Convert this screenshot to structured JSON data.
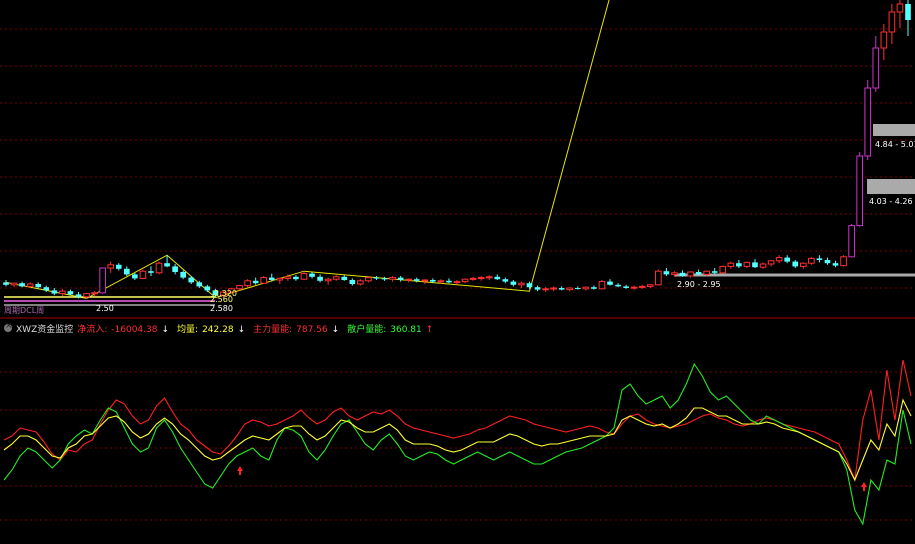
{
  "indicator_header": {
    "title": "XWZ资金监控",
    "items": [
      {
        "label": "净流入:",
        "value": "-16004.38",
        "arrow": "↓",
        "color": "red"
      },
      {
        "label": "均量:",
        "value": "242.28",
        "arrow": "↓",
        "color": "yellow"
      },
      {
        "label": "主力量能:",
        "value": "787.56",
        "arrow": "↓",
        "color": "red"
      },
      {
        "label": "散户量能:",
        "value": "360.81",
        "arrow": "↑",
        "color": "green"
      }
    ]
  },
  "price_labels": [
    {
      "text": "4.84 - 5.01"
    },
    {
      "text": "4.03 - 4.26"
    },
    {
      "text": "2.90 - 2.95"
    },
    {
      "text": "2.50"
    },
    {
      "text": "2.560"
    },
    {
      "text": "2.320"
    },
    {
      "text": "2.580"
    }
  ],
  "left_caption": "周期DCL周",
  "colors": {
    "up": "#ff3030",
    "down": "#54ffff",
    "zigzag": "#e6e600",
    "limit_up": "#cc33cc",
    "grid": "#7a0000",
    "support_box": "#aaaaaa",
    "main_force": "#ff2020",
    "retail": "#22ee22",
    "average": "#ffff33"
  },
  "chart_data": [
    {
      "type": "candlestick",
      "panel": "price",
      "y_range": [
        2.3,
        6.0
      ],
      "candles": [
        [
          2.52,
          2.55,
          2.47,
          2.49
        ],
        [
          2.49,
          2.52,
          2.46,
          2.51
        ],
        [
          2.51,
          2.53,
          2.46,
          2.47
        ],
        [
          2.47,
          2.52,
          2.45,
          2.5
        ],
        [
          2.5,
          2.52,
          2.44,
          2.46
        ],
        [
          2.46,
          2.48,
          2.4,
          2.42
        ],
        [
          2.42,
          2.45,
          2.36,
          2.38
        ],
        [
          2.38,
          2.44,
          2.35,
          2.41
        ],
        [
          2.41,
          2.43,
          2.36,
          2.37
        ],
        [
          2.37,
          2.4,
          2.32,
          2.34
        ],
        [
          2.34,
          2.39,
          2.32,
          2.38
        ],
        [
          2.38,
          2.41,
          2.35,
          2.39
        ],
        [
          2.39,
          2.7,
          2.38,
          2.7
        ],
        [
          2.7,
          2.78,
          2.64,
          2.74
        ],
        [
          2.74,
          2.76,
          2.67,
          2.69
        ],
        [
          2.69,
          2.72,
          2.6,
          2.62
        ],
        [
          2.62,
          2.64,
          2.55,
          2.57
        ],
        [
          2.57,
          2.68,
          2.56,
          2.66
        ],
        [
          2.66,
          2.72,
          2.6,
          2.64
        ],
        [
          2.64,
          2.78,
          2.62,
          2.76
        ],
        [
          2.76,
          2.86,
          2.71,
          2.72
        ],
        [
          2.72,
          2.75,
          2.62,
          2.65
        ],
        [
          2.65,
          2.67,
          2.56,
          2.58
        ],
        [
          2.58,
          2.6,
          2.5,
          2.52
        ],
        [
          2.52,
          2.54,
          2.45,
          2.47
        ],
        [
          2.47,
          2.49,
          2.4,
          2.42
        ],
        [
          2.42,
          2.44,
          2.33,
          2.36
        ],
        [
          2.36,
          2.41,
          2.33,
          2.4
        ],
        [
          2.4,
          2.45,
          2.38,
          2.44
        ],
        [
          2.44,
          2.49,
          2.42,
          2.48
        ],
        [
          2.48,
          2.56,
          2.46,
          2.54
        ],
        [
          2.54,
          2.58,
          2.49,
          2.51
        ],
        [
          2.51,
          2.6,
          2.5,
          2.58
        ],
        [
          2.58,
          2.63,
          2.53,
          2.55
        ],
        [
          2.55,
          2.58,
          2.5,
          2.57
        ],
        [
          2.57,
          2.62,
          2.54,
          2.59
        ],
        [
          2.59,
          2.61,
          2.54,
          2.56
        ],
        [
          2.56,
          2.66,
          2.55,
          2.63
        ],
        [
          2.63,
          2.65,
          2.57,
          2.59
        ],
        [
          2.59,
          2.62,
          2.52,
          2.54
        ],
        [
          2.54,
          2.58,
          2.49,
          2.56
        ],
        [
          2.56,
          2.61,
          2.54,
          2.59
        ],
        [
          2.59,
          2.61,
          2.54,
          2.55
        ],
        [
          2.55,
          2.57,
          2.48,
          2.5
        ],
        [
          2.5,
          2.56,
          2.48,
          2.54
        ],
        [
          2.54,
          2.6,
          2.52,
          2.58
        ],
        [
          2.58,
          2.6,
          2.55,
          2.57
        ],
        [
          2.57,
          2.59,
          2.54,
          2.56
        ],
        [
          2.56,
          2.6,
          2.53,
          2.58
        ],
        [
          2.58,
          2.6,
          2.53,
          2.55
        ],
        [
          2.55,
          2.57,
          2.52,
          2.56
        ],
        [
          2.56,
          2.58,
          2.52,
          2.54
        ],
        [
          2.54,
          2.56,
          2.5,
          2.55
        ],
        [
          2.55,
          2.57,
          2.51,
          2.53
        ],
        [
          2.53,
          2.56,
          2.5,
          2.54
        ],
        [
          2.54,
          2.57,
          2.51,
          2.52
        ],
        [
          2.52,
          2.55,
          2.49,
          2.53
        ],
        [
          2.53,
          2.57,
          2.51,
          2.56
        ],
        [
          2.56,
          2.59,
          2.54,
          2.57
        ],
        [
          2.57,
          2.6,
          2.54,
          2.58
        ],
        [
          2.58,
          2.61,
          2.55,
          2.59
        ],
        [
          2.59,
          2.62,
          2.55,
          2.56
        ],
        [
          2.56,
          2.58,
          2.51,
          2.53
        ],
        [
          2.53,
          2.55,
          2.47,
          2.49
        ],
        [
          2.49,
          2.53,
          2.45,
          2.51
        ],
        [
          2.51,
          2.53,
          2.44,
          2.46
        ],
        [
          2.46,
          2.48,
          2.41,
          2.43
        ],
        [
          2.43,
          2.46,
          2.4,
          2.44
        ],
        [
          2.44,
          2.47,
          2.41,
          2.45
        ],
        [
          2.45,
          2.47,
          2.42,
          2.43
        ],
        [
          2.43,
          2.46,
          2.41,
          2.45
        ],
        [
          2.45,
          2.47,
          2.43,
          2.44
        ],
        [
          2.44,
          2.47,
          2.42,
          2.46
        ],
        [
          2.46,
          2.48,
          2.43,
          2.44
        ],
        [
          2.44,
          2.55,
          2.43,
          2.53
        ],
        [
          2.53,
          2.56,
          2.48,
          2.49
        ],
        [
          2.49,
          2.51,
          2.46,
          2.47
        ],
        [
          2.47,
          2.49,
          2.44,
          2.45
        ],
        [
          2.45,
          2.48,
          2.43,
          2.46
        ],
        [
          2.46,
          2.49,
          2.44,
          2.47
        ],
        [
          2.47,
          2.5,
          2.45,
          2.49
        ],
        [
          2.49,
          2.68,
          2.48,
          2.66
        ],
        [
          2.66,
          2.7,
          2.6,
          2.62
        ],
        [
          2.62,
          2.66,
          2.59,
          2.64
        ],
        [
          2.64,
          2.67,
          2.59,
          2.6
        ],
        [
          2.6,
          2.66,
          2.58,
          2.65
        ],
        [
          2.65,
          2.68,
          2.61,
          2.62
        ],
        [
          2.62,
          2.67,
          2.6,
          2.66
        ],
        [
          2.66,
          2.7,
          2.62,
          2.64
        ],
        [
          2.64,
          2.73,
          2.63,
          2.72
        ],
        [
          2.72,
          2.78,
          2.69,
          2.76
        ],
        [
          2.76,
          2.8,
          2.7,
          2.72
        ],
        [
          2.72,
          2.78,
          2.7,
          2.77
        ],
        [
          2.77,
          2.81,
          2.7,
          2.71
        ],
        [
          2.71,
          2.77,
          2.69,
          2.75
        ],
        [
          2.75,
          2.8,
          2.72,
          2.79
        ],
        [
          2.79,
          2.86,
          2.76,
          2.83
        ],
        [
          2.83,
          2.86,
          2.76,
          2.78
        ],
        [
          2.78,
          2.8,
          2.7,
          2.72
        ],
        [
          2.72,
          2.77,
          2.69,
          2.76
        ],
        [
          2.76,
          2.84,
          2.74,
          2.82
        ],
        [
          2.82,
          2.86,
          2.77,
          2.8
        ],
        [
          2.8,
          2.83,
          2.74,
          2.76
        ],
        [
          2.76,
          2.79,
          2.71,
          2.73
        ],
        [
          2.73,
          2.86,
          2.72,
          2.84
        ],
        [
          2.84,
          3.25,
          2.83,
          3.23
        ],
        [
          3.23,
          4.15,
          3.22,
          4.1
        ],
        [
          4.1,
          5.05,
          4.05,
          4.95
        ],
        [
          4.95,
          5.6,
          4.9,
          5.45
        ],
        [
          5.45,
          5.75,
          5.3,
          5.65
        ],
        [
          5.65,
          6.0,
          5.5,
          5.9
        ],
        [
          5.9,
          6.1,
          5.7,
          6.0
        ],
        [
          6.0,
          6.1,
          5.6,
          5.8
        ]
      ]
    },
    {
      "type": "line",
      "panel": "indicator",
      "y_range": [
        0,
        100
      ],
      "series": [
        {
          "name": "主力量能",
          "values": [
            50,
            52,
            56,
            55,
            54,
            49,
            43,
            40,
            45,
            44,
            48,
            50,
            58,
            65,
            70,
            68,
            62,
            58,
            60,
            67,
            71,
            64,
            58,
            55,
            50,
            47,
            44,
            43,
            47,
            52,
            58,
            60,
            59,
            57,
            58,
            60,
            62,
            65,
            61,
            58,
            60,
            64,
            66,
            62,
            60,
            62,
            64,
            63,
            65,
            62,
            58,
            56,
            55,
            54,
            53,
            52,
            51,
            52,
            53,
            55,
            56,
            58,
            60,
            62,
            61,
            60,
            58,
            57,
            56,
            55,
            54,
            55,
            56,
            57,
            56,
            54,
            53,
            58,
            62,
            63,
            60,
            58,
            57,
            56,
            57,
            58,
            60,
            62,
            63,
            61,
            60,
            58,
            57,
            58,
            60,
            61,
            60,
            58,
            57,
            56,
            55,
            54,
            52,
            50,
            48,
            40,
            30,
            60,
            75,
            50,
            85,
            60,
            90,
            72
          ]
        },
        {
          "name": "散户量能",
          "values": [
            30,
            35,
            42,
            46,
            44,
            40,
            36,
            40,
            48,
            52,
            55,
            53,
            60,
            66,
            64,
            56,
            48,
            44,
            46,
            56,
            60,
            54,
            46,
            40,
            34,
            28,
            26,
            32,
            38,
            42,
            44,
            46,
            42,
            40,
            50,
            56,
            55,
            52,
            44,
            40,
            45,
            52,
            58,
            60,
            54,
            48,
            45,
            50,
            53,
            48,
            42,
            40,
            42,
            44,
            43,
            40,
            38,
            40,
            42,
            44,
            42,
            40,
            42,
            44,
            42,
            40,
            38,
            38,
            40,
            42,
            44,
            45,
            46,
            48,
            50,
            52,
            56,
            75,
            78,
            72,
            68,
            70,
            72,
            66,
            70,
            78,
            88,
            82,
            74,
            70,
            72,
            68,
            64,
            60,
            58,
            62,
            60,
            58,
            56,
            54,
            52,
            50,
            48,
            46,
            44,
            35,
            15,
            8,
            30,
            25,
            40,
            38,
            65,
            48
          ]
        },
        {
          "name": "均量",
          "values": [
            45,
            48,
            52,
            52,
            50,
            46,
            42,
            41,
            46,
            48,
            52,
            53,
            57,
            61,
            62,
            59,
            54,
            51,
            53,
            58,
            61,
            58,
            53,
            50,
            46,
            42,
            40,
            41,
            44,
            47,
            50,
            52,
            51,
            50,
            53,
            56,
            57,
            57,
            53,
            50,
            52,
            56,
            60,
            59,
            56,
            54,
            54,
            56,
            58,
            55,
            50,
            48,
            48,
            48,
            47,
            45,
            44,
            45,
            47,
            49,
            49,
            49,
            51,
            53,
            52,
            50,
            48,
            47,
            48,
            48,
            49,
            50,
            51,
            52,
            52,
            52,
            53,
            60,
            62,
            60,
            58,
            57,
            58,
            56,
            58,
            61,
            66,
            66,
            64,
            62,
            62,
            60,
            58,
            58,
            58,
            59,
            58,
            56,
            55,
            54,
            52,
            50,
            48,
            46,
            44,
            38,
            30,
            40,
            50,
            45,
            58,
            52,
            70,
            62
          ]
        }
      ]
    }
  ]
}
